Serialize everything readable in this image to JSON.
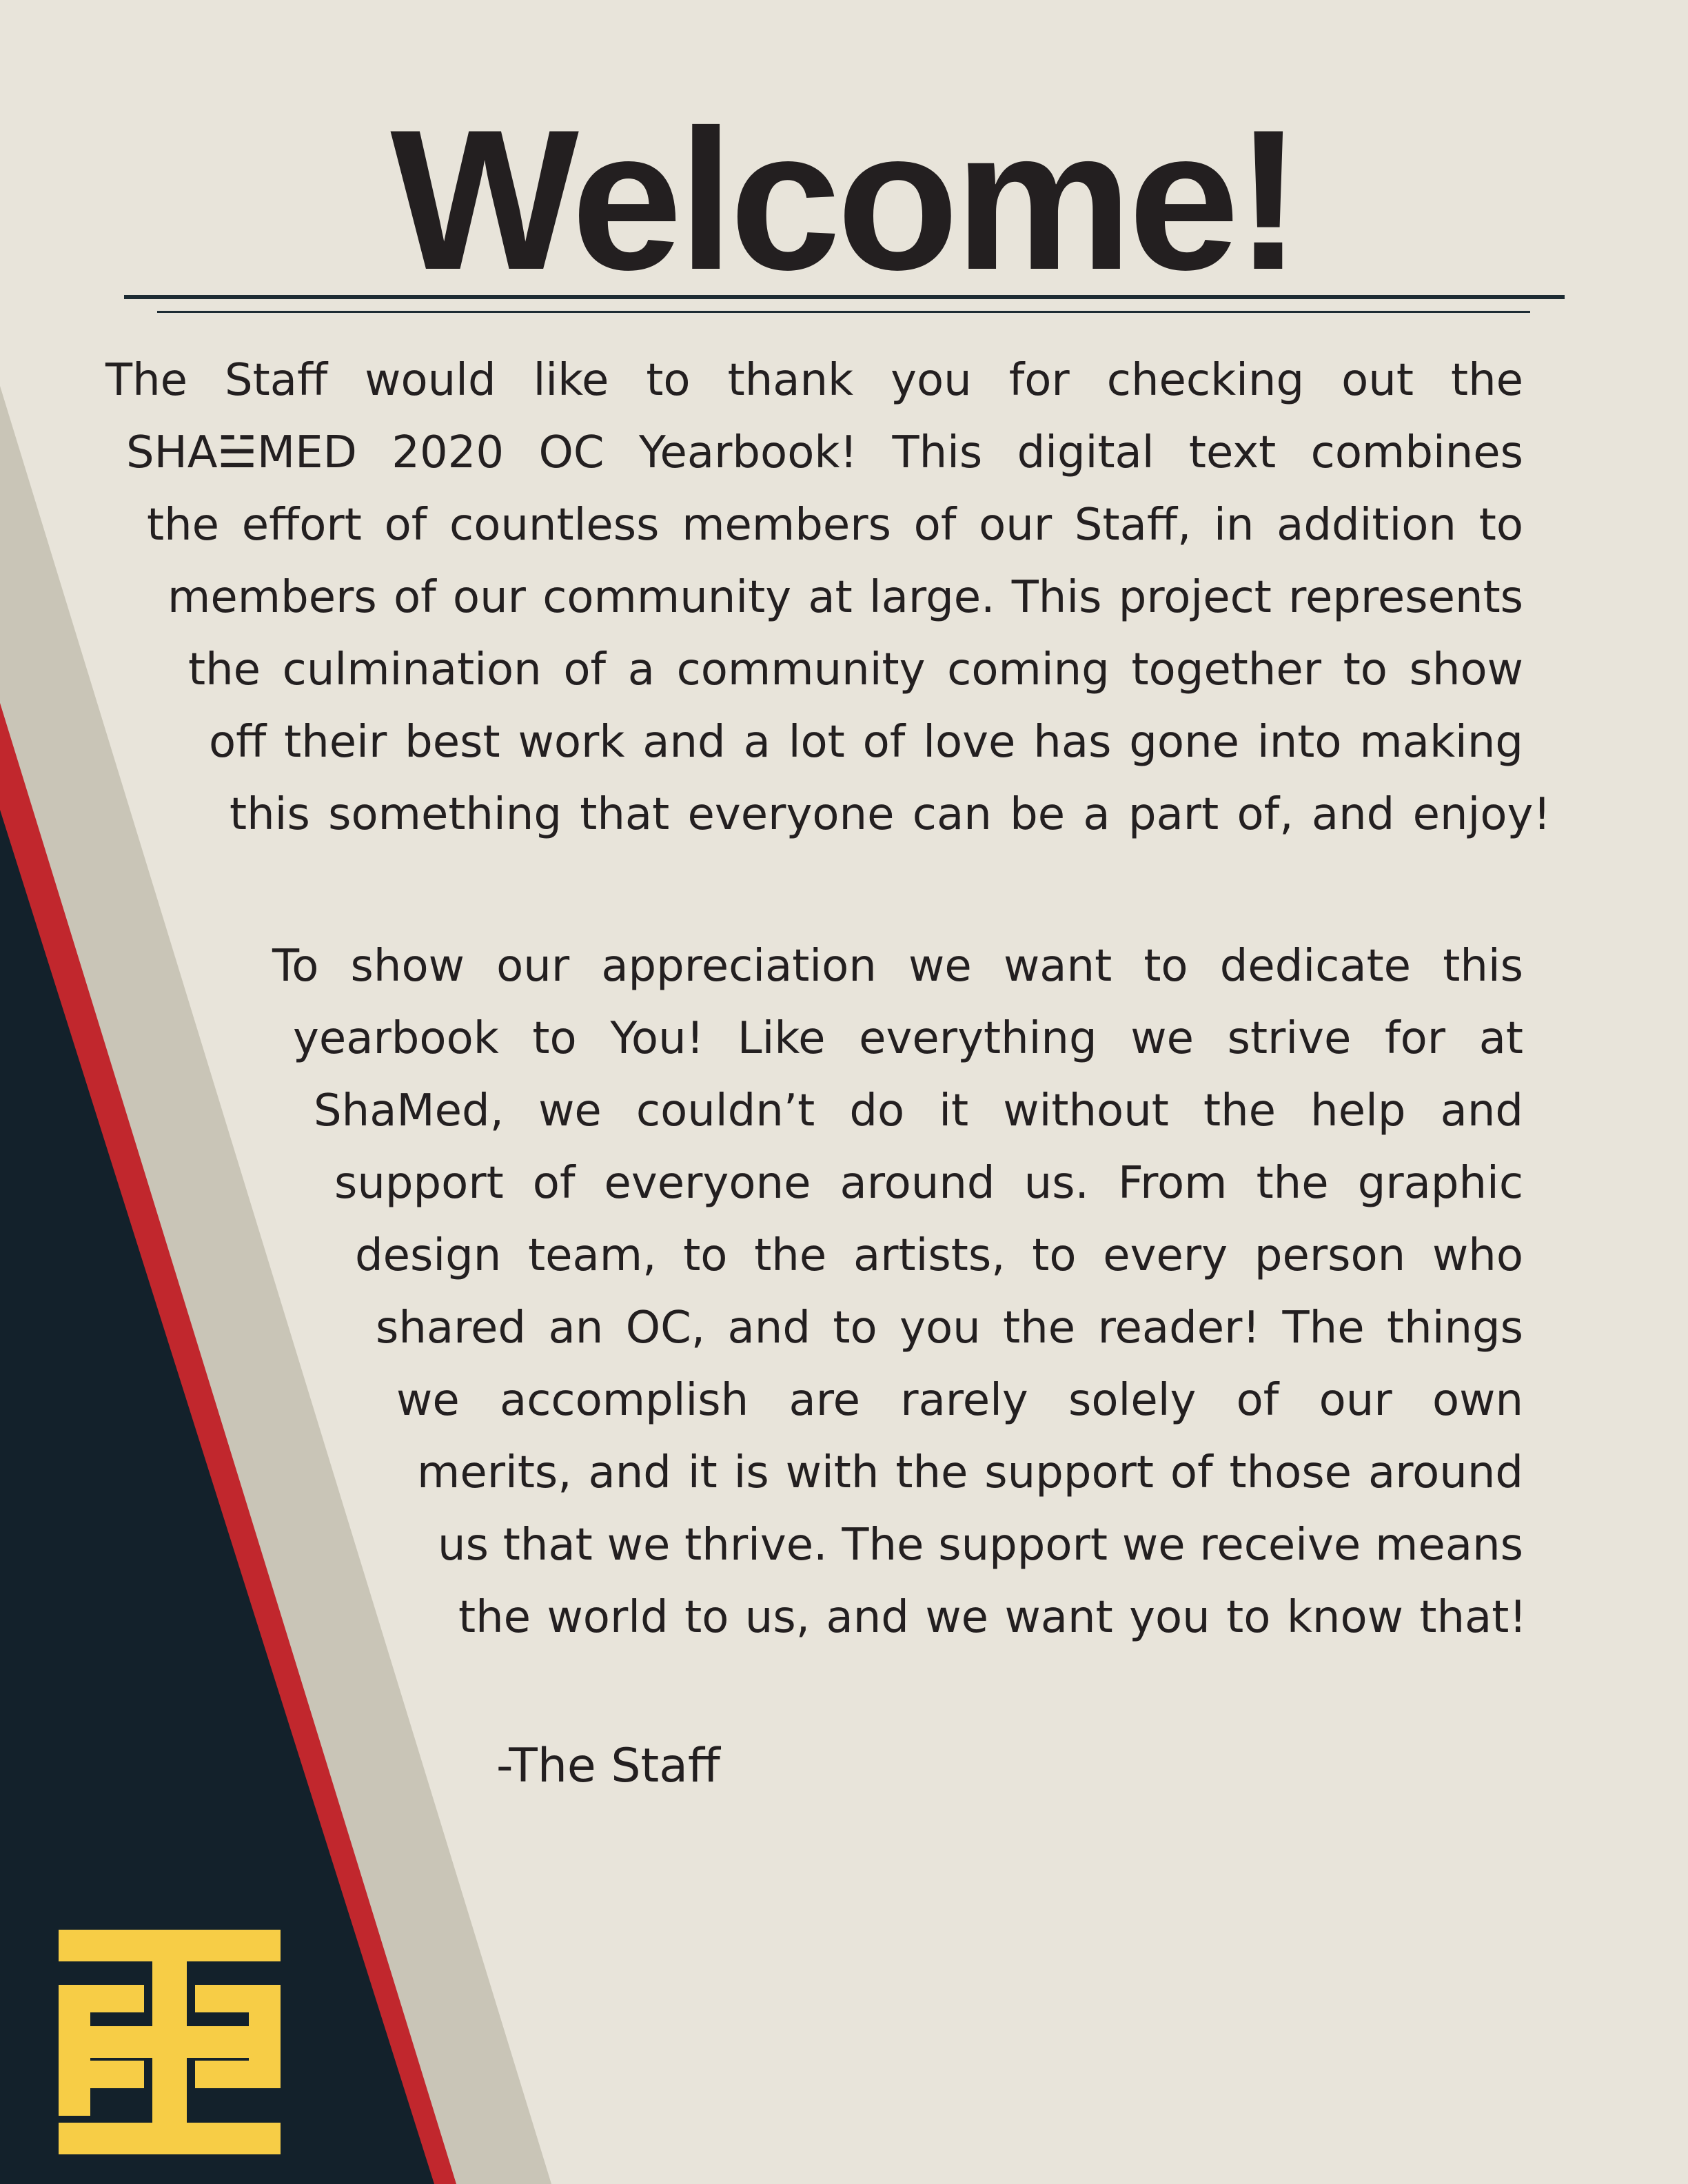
{
  "title": "Welcome!",
  "paragraph_1": [
    "The Staff would like to thank you for checking out the",
    "SHA☱MED 2020 OC Yearbook! This digital text combines",
    "the effort of countless members of our Staff, in addition to",
    "members of our community at large. This project represents",
    "the culmination of a community coming together to show",
    "off their best work and a lot of love has gone into making",
    "this something that everyone can be a part of, and enjoy!"
  ],
  "paragraph_2": [
    "To show our appreciation we want to dedicate this",
    "yearbook to You! Like everything we strive for at",
    "ShaMed, we couldn’t do it without the help and",
    "support of everyone around us. From the graphic",
    "design team, to the artists, to every person who",
    "shared an OC, and to you the reader! The things",
    "we accomplish are rarely solely of our own",
    "merits, and it is with the support of those around",
    "us that we thrive. The support we receive means",
    "the world to us, and we want you to know that!"
  ],
  "signature": "-The Staff",
  "colors": {
    "background": "#e8e4da",
    "light_stripe": "#c9c5b7",
    "red_stripe": "#c1272d",
    "navy": "#13212b",
    "logo_yellow": "#f7cd46",
    "text": "#231f20"
  },
  "icons": {
    "logo": "shamed-cross-logo-icon"
  }
}
